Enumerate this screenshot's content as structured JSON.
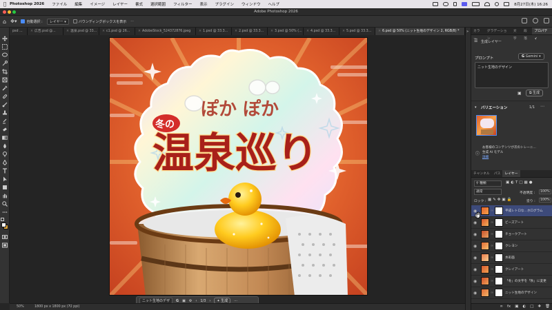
{
  "menubar": {
    "app_name": "Photoshop 2026",
    "items": [
      "ファイル",
      "編集",
      "イメージ",
      "レイヤー",
      "書式",
      "選択範囲",
      "フィルター",
      "表示",
      "プラグイン",
      "ウィンドウ",
      "ヘルプ"
    ],
    "datetime": "8月27日(木) 16:26"
  },
  "window": {
    "title": "Adobe Photoshop 2026"
  },
  "options": {
    "auto_select_label": "自動選択 :",
    "auto_select_target": "レイヤー",
    "bounding_box_label": "バウンディングボックスを表示"
  },
  "tabs": [
    {
      "label": "psd ..."
    },
    {
      "label": "広告.psd @..."
    },
    {
      "label": "温泉.psd @ 33..."
    },
    {
      "label": "c1.psd @ 26..."
    },
    {
      "label": "AdobeStock_524372876.jpeg"
    },
    {
      "label": "1.psd @ 33.3..."
    },
    {
      "label": "2.psd @ 33.3..."
    },
    {
      "label": "3.psd @ 50% (..."
    },
    {
      "label": "4.psd @ 33.3..."
    },
    {
      "label": "5.psd @ 33.3..."
    },
    {
      "label": "6.psd @ 50% (ニット生地のデザイン 2, RGB/8) *"
    }
  ],
  "artwork": {
    "line1": "ぽか ぽか",
    "badge": "冬の",
    "main_title": "温泉巡り"
  },
  "context_bar": {
    "prompt_value": "ニット生地のデザ",
    "pager": "1/3",
    "generate_label": "生成"
  },
  "status": {
    "zoom": "50%",
    "doc_info": "1800 px x 1800 px (72 ppi)"
  },
  "panel": {
    "top_tabs": [
      "カラー",
      "グラデーション",
      "文字",
      "段落",
      "プロパティ"
    ],
    "properties_subtitle": "生成レイヤー",
    "prompt_label": "プロンプト",
    "model_label": "Gemini",
    "prompt_text": "ニット生地のデザイン",
    "generate_label": "生成",
    "variations_label": "バリエーション",
    "variations_count": "1/1",
    "notice_text": "お客様のコンテンツが次のトレーニ...",
    "notice_text2": "生成 AI モデル",
    "notice_link": "詳細",
    "layers_tabs": [
      "チャンネル",
      "パス",
      "レイヤー"
    ],
    "filter_label": "種類",
    "blend_mode": "通常",
    "opacity_label": "不透明度 :",
    "opacity_value": "100%",
    "lock_label": "ロック :",
    "fill_label": "塗り :",
    "fill_value": "100%"
  },
  "layers": [
    {
      "name": "平成レトロな...ホログラム",
      "selected": true
    },
    {
      "name": "ビーズアート",
      "selected": false
    },
    {
      "name": "チョークアート",
      "selected": false
    },
    {
      "name": "クレヨン",
      "selected": false
    },
    {
      "name": "水彩画",
      "selected": false
    },
    {
      "name": "クレイアート",
      "selected": false
    },
    {
      "name": "「冬」の文字を「秋」に変更",
      "selected": false
    },
    {
      "name": "ニット生地のデザイン",
      "selected": false
    }
  ],
  "colors": {
    "accent": "#4a8cf7",
    "selection": "#3d4a7a",
    "artwork_bg": "#d9542a",
    "title_red": "#a8201a"
  }
}
